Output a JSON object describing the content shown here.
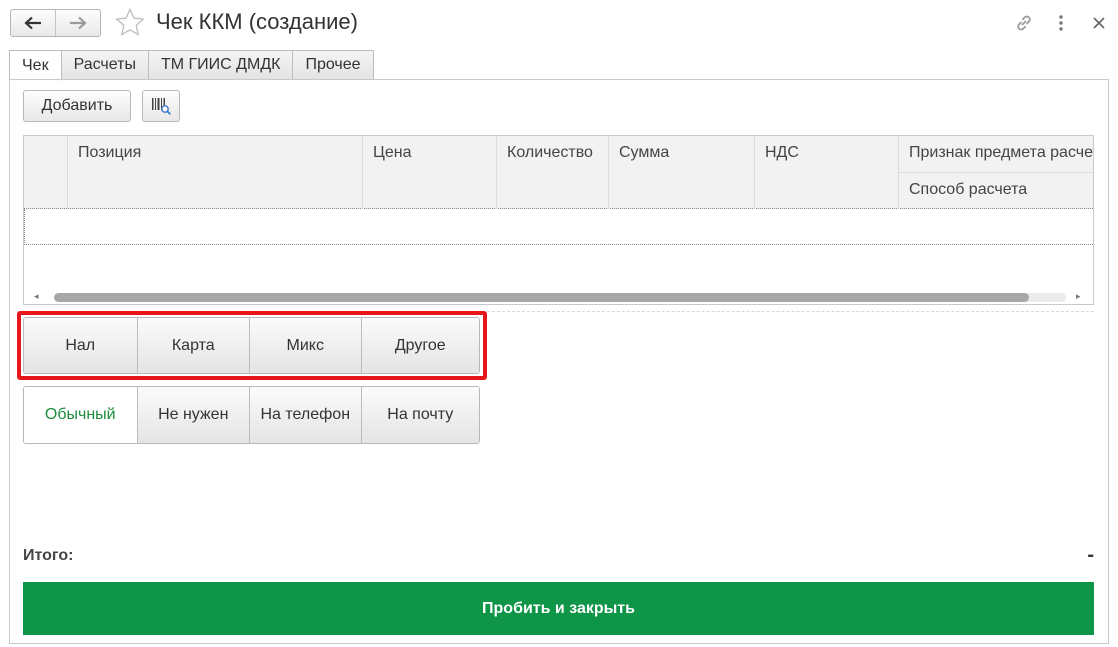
{
  "window": {
    "title": "Чек ККМ (создание)"
  },
  "tabs": [
    {
      "label": "Чек",
      "active": true
    },
    {
      "label": "Расчеты"
    },
    {
      "label": "ТМ ГИИС ДМДК"
    },
    {
      "label": "Прочее"
    }
  ],
  "toolbar": {
    "add_label": "Добавить"
  },
  "table": {
    "columns": [
      "Позиция",
      "Цена",
      "Количество",
      "Сумма",
      "НДС",
      "Признак предмета расчета"
    ],
    "subcolumn": "Способ расчета"
  },
  "payment_type": {
    "options": [
      "Нал",
      "Карта",
      "Микс",
      "Другое"
    ]
  },
  "receipt_mode": {
    "options": [
      "Обычный",
      "Не нужен",
      "На телефон",
      "На почту"
    ],
    "selected": "Обычный"
  },
  "totals": {
    "label": "Итого:",
    "value": "-"
  },
  "actions": {
    "submit_label": "Пробить и закрыть"
  },
  "colors": {
    "accent": "#0e9547",
    "highlight": "#e8161b",
    "selected_text": "#1c8c3e"
  },
  "icons": [
    "back-arrow-icon",
    "forward-arrow-icon",
    "star-icon",
    "link-icon",
    "more-icon",
    "close-icon",
    "barcode-scan-icon"
  ]
}
